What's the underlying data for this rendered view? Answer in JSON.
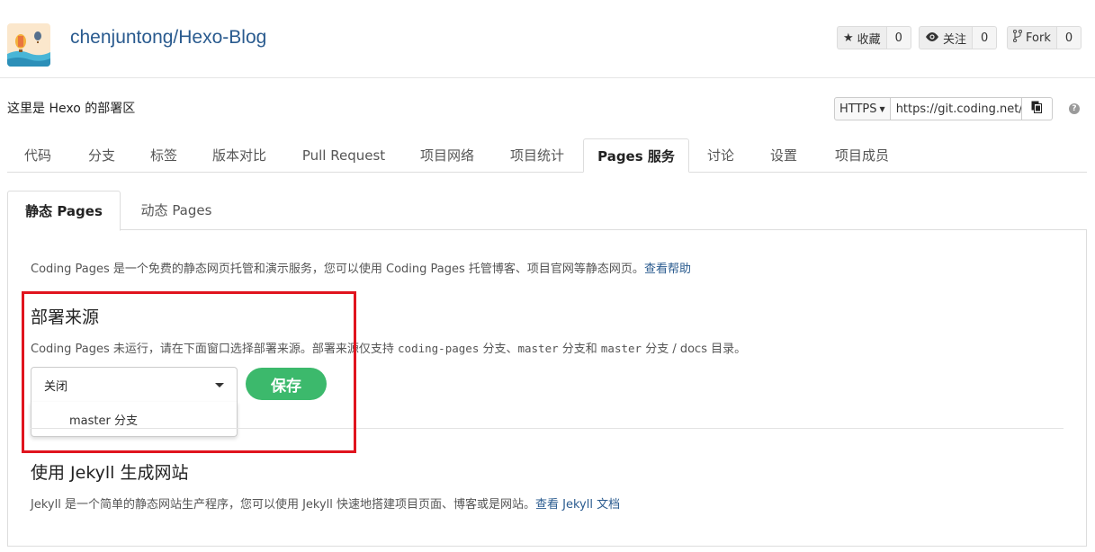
{
  "repo": {
    "title": "chenjuntong/Hexo-Blog",
    "description": "这里是 Hexo 的部署区"
  },
  "social": {
    "star_label": "收藏",
    "star_count": "0",
    "watch_label": "关注",
    "watch_count": "0",
    "fork_label": "Fork",
    "fork_count": "0"
  },
  "clone": {
    "protocol": "HTTPS",
    "url": "https://git.coding.net/"
  },
  "main_tabs": [
    {
      "label": "代码"
    },
    {
      "label": "分支"
    },
    {
      "label": "标签"
    },
    {
      "label": "版本对比"
    },
    {
      "label": "Pull Request"
    },
    {
      "label": "项目网络"
    },
    {
      "label": "项目统计"
    },
    {
      "label": "Pages 服务",
      "active": true
    },
    {
      "label": "讨论"
    },
    {
      "label": "设置"
    },
    {
      "label": "项目成员"
    }
  ],
  "sub_tabs": [
    {
      "label": "静态 Pages",
      "active": true
    },
    {
      "label": "动态 Pages"
    }
  ],
  "panel": {
    "intro_text": "Coding Pages 是一个免费的静态网页托管和演示服务，您可以使用 Coding Pages 托管博客、项目官网等静态网页。",
    "intro_link": "查看帮助",
    "deploy": {
      "title": "部署来源",
      "text_a": "Coding Pages 未运行，请在下面窗口选择部署来源。部署来源仅支持 ",
      "code_a": "coding-pages",
      "text_b": " 分支、",
      "code_b": "master",
      "text_c": " 分支和 ",
      "code_c": "master",
      "text_d": " 分支 / docs 目录。",
      "select_value": "关闭",
      "dropdown_option": "master 分支",
      "save_label": "保存"
    },
    "jekyll": {
      "title": "使用 Jekyll 生成网站",
      "text": "Jekyll 是一个简单的静态网站生产程序，您可以使用 Jekyll 快速地搭建项目页面、博客或是网站。",
      "link": "查看 Jekyll 文档"
    }
  },
  "colors": {
    "link": "#2a5b8f",
    "save_button": "#3cb96c",
    "highlight": "#e0141e"
  }
}
